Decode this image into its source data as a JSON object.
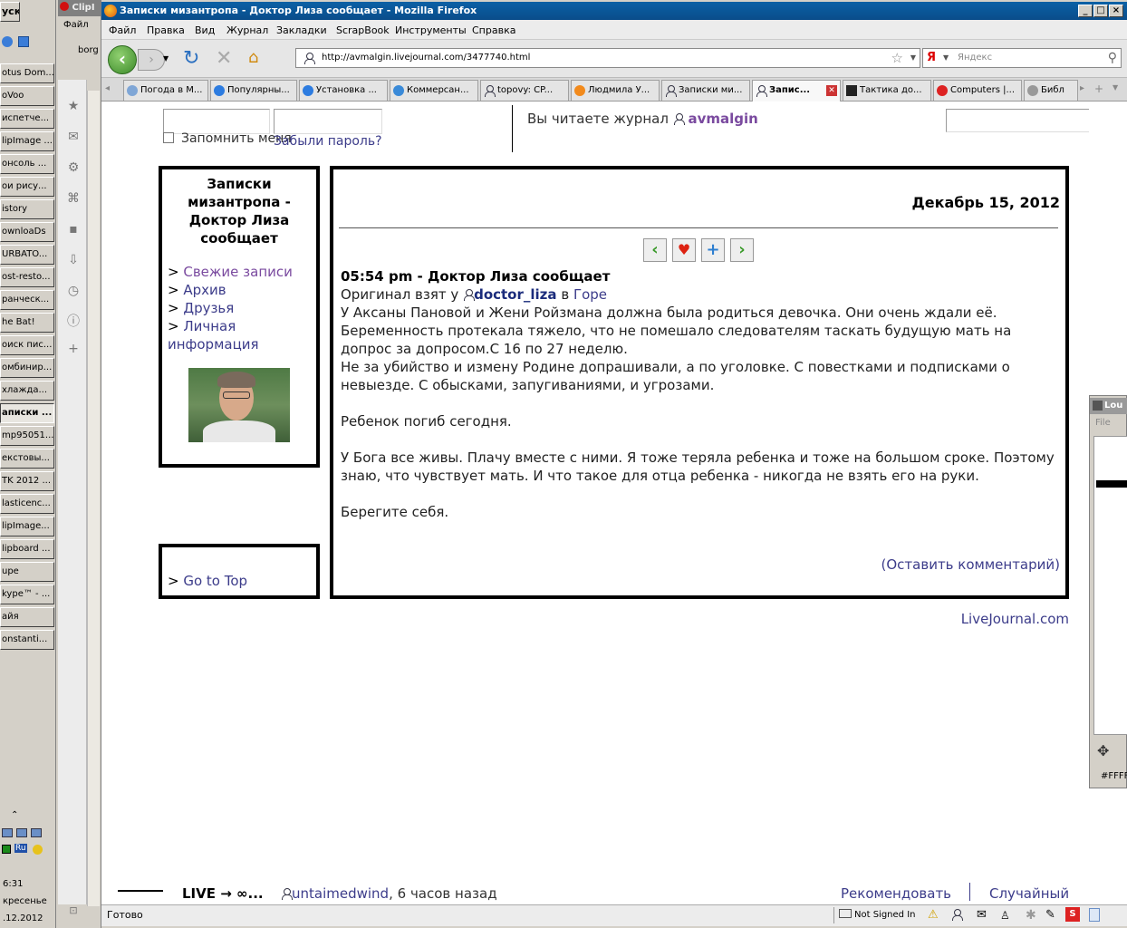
{
  "taskbar": {
    "start_label": "уск",
    "items": [
      {
        "label": "otus Dom..."
      },
      {
        "label": "oVoo"
      },
      {
        "label": "испетче..."
      },
      {
        "label": "lipImage ..."
      },
      {
        "label": "онсоль ..."
      },
      {
        "label": "ои рису..."
      },
      {
        "label": "istory"
      },
      {
        "label": "ownloaDs"
      },
      {
        "label": "URBATO..."
      },
      {
        "label": "ost-resto..."
      },
      {
        "label": "ранческ..."
      },
      {
        "label": "he Bat!"
      },
      {
        "label": "оиск пис..."
      },
      {
        "label": "омбинир..."
      },
      {
        "label": "хлажда..."
      },
      {
        "label": "аписки ..."
      },
      {
        "label": "mp95051..."
      },
      {
        "label": "екстовы..."
      },
      {
        "label": "TK 2012 ..."
      },
      {
        "label": "lasticenc..."
      },
      {
        "label": "lipImage..."
      },
      {
        "label": "lipboard ..."
      },
      {
        "label": "upe"
      },
      {
        "label": "kype™ - ..."
      },
      {
        "label": "айя"
      },
      {
        "label": "onstanti..."
      }
    ],
    "tray_lang": "Ru",
    "clock_time": "6:31",
    "clock_day": "кресенье",
    "clock_date": ".12.2012"
  },
  "clip_window": {
    "title": "ClipI",
    "menu_file": "Файл",
    "item": "borg"
  },
  "browser": {
    "title": "Записки мизантропа - Доктор Лиза сообщает - Mozilla Firefox",
    "menu": [
      "Файл",
      "Правка",
      "Вид",
      "Журнал",
      "Закладки",
      "ScrapBook",
      "Инструменты",
      "Справка"
    ],
    "url": "http://avmalgin.livejournal.com/3477740.html",
    "search_engine": "Я",
    "search_placeholder": "Яндекс",
    "tabs": [
      {
        "label": "Погода в М..."
      },
      {
        "label": "Популярны..."
      },
      {
        "label": "Установка ..."
      },
      {
        "label": "Коммерсан..."
      },
      {
        "label": "topovy: CP..."
      },
      {
        "label": "Людмила У..."
      },
      {
        "label": "Записки ми..."
      },
      {
        "label": "Запис...",
        "active": true
      },
      {
        "label": "Тактика до..."
      },
      {
        "label": "Computers |..."
      },
      {
        "label": "Библ"
      }
    ],
    "status": "Готово",
    "status_right": "Not Signed In"
  },
  "lj": {
    "remember_label": "Запомнить меня",
    "forgot_label": "Забыли пароль?",
    "reading_label": "Вы читаете журнал",
    "journal_user": "avmalgin",
    "journal_title": "Записки мизантропа - Доктор Лиза сообщает",
    "nav": {
      "recent": "Свежие записи",
      "archive": "Архив",
      "friends": "Друзья",
      "info": "Личная информация",
      "top": "Go to Top"
    },
    "date": "Декабрь 15, 2012",
    "post_time_title": "05:54 pm - Доктор Лиза сообщает",
    "orig_prefix": "Оригинал взят у",
    "orig_user": "doctor_liza",
    "orig_in": "в",
    "orig_post": "Горе",
    "p1": "У Аксаны Пановой и Жени Ройзмана должна была родиться девочка. Они очень ждали её. Беременность протекала тяжело, что не помешало следователям таскать будущую мать на допрос за допросом.С 16 по 27 неделю.",
    "p2": "Не за убийство и измену Родине допрашивали, а по уголовке. С повестками и подписками о невыезде. С обысками, запугиваниями, и угрозами.",
    "p3": "Ребенок погиб сегодня.",
    "p4": "У Бога все живы. Плачу вместе с ними. Я тоже теряла ребенка и тоже на большом сроке. Поэтому знаю, что чувствует мать. И что такое для отца ребенка - никогда не взять его на руки.",
    "p5": "Берегите себя.",
    "comment": "(Оставить комментарий)",
    "footer": "LiveJournal.com",
    "bottom_bar": {
      "live": "LIVE → ∞...",
      "user": "untaimedwind",
      "time": ", 6 часов назад",
      "recommend": "Рекомендовать",
      "random": "Случайный блог"
    }
  },
  "side_window": {
    "title": "Lou",
    "menu_file": "File",
    "color": "#FFFF"
  }
}
